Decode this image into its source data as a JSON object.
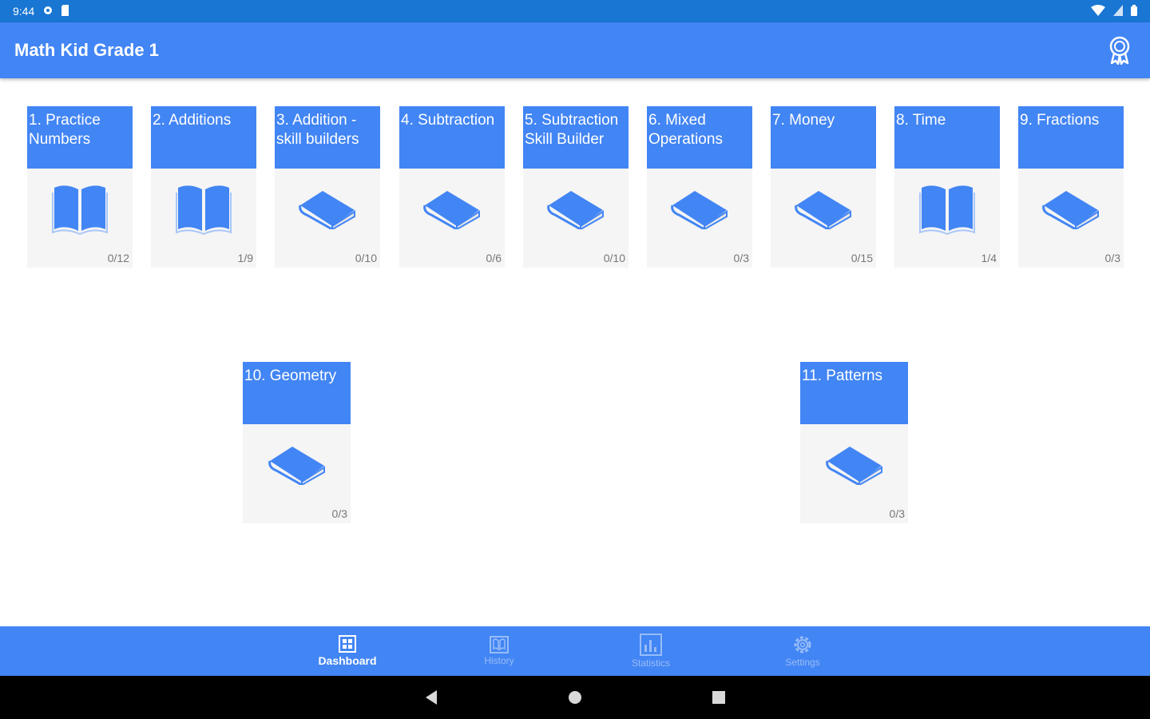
{
  "status": {
    "time": "9:44"
  },
  "app": {
    "title": "Math Kid Grade 1"
  },
  "topics": [
    {
      "title": "1. Practice Numbers",
      "progress": "0/12",
      "icon": "open-book-icon"
    },
    {
      "title": "2. Additions",
      "progress": "1/9",
      "icon": "open-book-icon"
    },
    {
      "title": "3. Addition - skill builders",
      "progress": "0/10",
      "icon": "closed-book-icon"
    },
    {
      "title": "4. Subtraction",
      "progress": "0/6",
      "icon": "closed-book-icon"
    },
    {
      "title": "5. Subtraction Skill Builder",
      "progress": "0/10",
      "icon": "closed-book-icon"
    },
    {
      "title": "6. Mixed Operations",
      "progress": "0/3",
      "icon": "closed-book-icon"
    },
    {
      "title": "7. Money",
      "progress": "0/15",
      "icon": "closed-book-icon"
    },
    {
      "title": "8. Time",
      "progress": "1/4",
      "icon": "open-book-icon"
    },
    {
      "title": "9. Fractions",
      "progress": "0/3",
      "icon": "closed-book-icon"
    },
    {
      "title": "10. Geometry",
      "progress": "0/3",
      "icon": "closed-book-icon"
    },
    {
      "title": "11. Patterns",
      "progress": "0/3",
      "icon": "closed-book-icon"
    }
  ],
  "nav": [
    {
      "label": "Dashboard",
      "icon": "dashboard-icon",
      "active": true
    },
    {
      "label": "History",
      "icon": "history-icon",
      "active": false
    },
    {
      "label": "Statistics",
      "icon": "statistics-icon",
      "active": false
    },
    {
      "label": "Settings",
      "icon": "settings-icon",
      "active": false
    }
  ],
  "colors": {
    "primary": "#4285f4",
    "status_bar": "#1976d2",
    "card_bg": "#f5f5f5"
  }
}
